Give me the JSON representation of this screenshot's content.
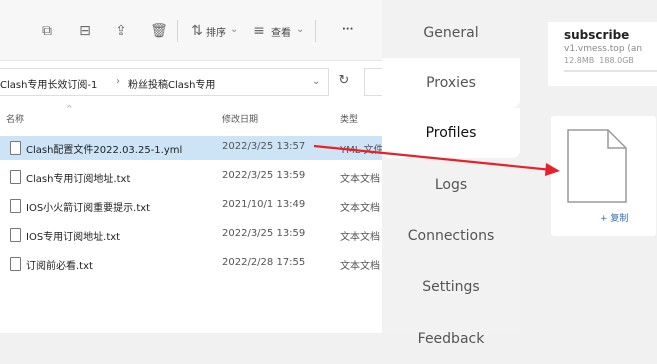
{
  "explorer": {
    "toolbar": {
      "sort_label": "排序",
      "view_label": "查看",
      "more_label": "···"
    },
    "breadcrumb": {
      "part1": "Clash专用长效订阅-1",
      "separator": "›",
      "part2": "粉丝投稿Clash专用"
    },
    "columns": {
      "name": "名称",
      "modified": "修改日期",
      "type": "类型"
    },
    "files": [
      {
        "name": "Clash配置文件2022.03.25-1.yml",
        "date": "2022/3/25 13:57",
        "type": "YML 文件",
        "selected": true
      },
      {
        "name": "Clash专用订阅地址.txt",
        "date": "2022/3/25 13:59",
        "type": "文本文档"
      },
      {
        "name": "IOS小火箭订阅重要提示.txt",
        "date": "2021/10/1 13:49",
        "type": "文本文档"
      },
      {
        "name": "IOS专用订阅地址.txt",
        "date": "2022/3/25 13:59",
        "type": "文本文档"
      },
      {
        "name": "订阅前必看.txt",
        "date": "2022/2/28 17:55",
        "type": "文本文档"
      }
    ]
  },
  "menu": {
    "items": [
      {
        "label": "General"
      },
      {
        "label": "Proxies"
      },
      {
        "label": "Profiles",
        "active": true
      },
      {
        "label": "Logs"
      },
      {
        "label": "Connections"
      },
      {
        "label": "Settings"
      },
      {
        "label": "Feedback"
      }
    ]
  },
  "profile_card": {
    "title": "subscribe",
    "url": "v1.vmess.top (an",
    "used": "12.8MB",
    "total": "188.0GB"
  },
  "drop_zone": {
    "copy_label": "+ 复制"
  },
  "colors": {
    "selection": "#cde4f7",
    "arrow": "#e8202a",
    "link": "#2f6fb8"
  }
}
